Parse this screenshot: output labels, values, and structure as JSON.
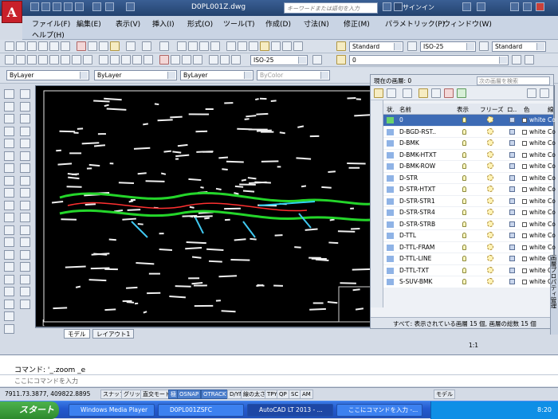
{
  "titlebar": {
    "doc_title": "D0PL001Z.dwg",
    "search_placeholder": "キーワードまたは語句を入力",
    "signin": "サインイン"
  },
  "menu": {
    "items": [
      "ファイル(F)",
      "編集(E)",
      "表示(V)",
      "挿入(I)",
      "形式(O)",
      "ツール(T)",
      "作成(D)",
      "寸法(N)",
      "修正(M)",
      "パラメトリック(P)",
      "ウィンドウ(W)"
    ],
    "help": "ヘルプ(H)"
  },
  "toolbar": {
    "text_style": "Standard",
    "dim_style": "ISO-25",
    "table_style": "Standard",
    "dim_style2": "ISO-25",
    "layer_current": "0"
  },
  "properties": {
    "color": "ByLayer",
    "linetype": "ByLayer",
    "lineweight": "ByLayer",
    "plotstyle": "ByColor"
  },
  "layout_tabs": [
    "モデル",
    "レイアウト1"
  ],
  "layer_palette": {
    "current_layer": "現在の画層: 0",
    "search_placeholder": "次の画層を検索",
    "columns": [
      "状.",
      "名前",
      "表示",
      "フリーズ",
      "ロ..",
      "色",
      "線"
    ],
    "layers": [
      {
        "name": "0",
        "color": "white"
      },
      {
        "name": "D-BGD-RST..",
        "color": "white"
      },
      {
        "name": "D-BMK",
        "color": "white"
      },
      {
        "name": "D-BMK-HTXT",
        "color": "white"
      },
      {
        "name": "D-BMK-ROW",
        "color": "white"
      },
      {
        "name": "D-STR",
        "color": "white"
      },
      {
        "name": "D-STR-HTXT",
        "color": "white"
      },
      {
        "name": "D-STR-STR1",
        "color": "white"
      },
      {
        "name": "D-STR-STR4",
        "color": "white"
      },
      {
        "name": "D-STR-STRB",
        "color": "white"
      },
      {
        "name": "D-TTL",
        "color": "white"
      },
      {
        "name": "D-TTL-FRAM",
        "color": "white"
      },
      {
        "name": "D-TTL-LINE",
        "color": "white"
      },
      {
        "name": "D-TTL-TXT",
        "color": "white"
      },
      {
        "name": "S-SUV-BMK",
        "color": "white"
      }
    ],
    "row_linetype": "Co",
    "status": "すべて: 表示されている画層 15 個, 画層の総数 15 個",
    "vertical_title": "画層プロパティ管理"
  },
  "command": {
    "line1": "コマンド: '_.zoom _e",
    "prompt": "ここにコマンドを入力"
  },
  "status": {
    "coords": "7911.73.3877, 409822.8895",
    "buttons": [
      "スナップ",
      "グリッド",
      "直交モード",
      "極",
      "OSNAP",
      "OTRACK",
      "D/YN",
      "線の太さ",
      "TPY",
      "QP",
      "SC",
      "AM"
    ],
    "model_label": "モデル",
    "annotation_scale": "1:1"
  },
  "taskbar": {
    "start": "スタート",
    "tasks": [
      "Windows Media Player",
      "D0PL001ZSFC",
      "AutoCAD LT 2013 - ...",
      "ここにコマンドを入力 -..."
    ],
    "clock": "8:20"
  }
}
